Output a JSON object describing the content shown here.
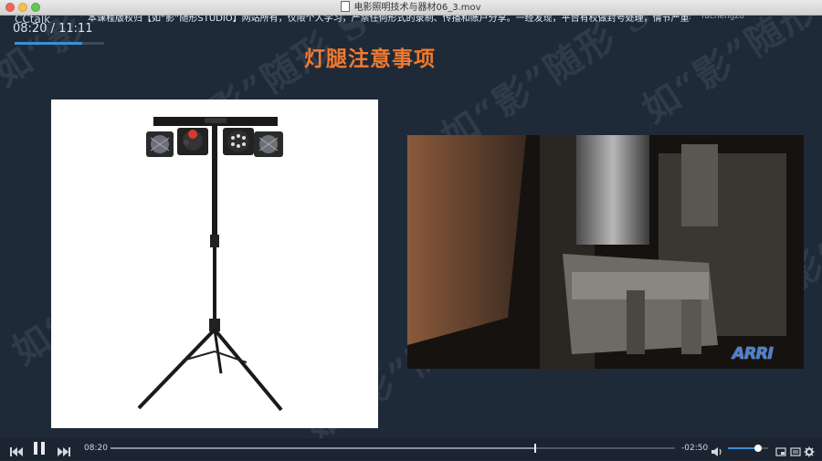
{
  "window": {
    "title": "电影照明技术与器材06_3.mov"
  },
  "overlay": {
    "app_name": "CCtalk",
    "notice": "本课程版权归【如“影”随形STUDIO】网站所有，仅限个人学习，严禁任何形式的录制、传播和账户分享。一经发现，平台有权做封号处理，情节严重者将承担法律责任。",
    "username": "fuchengzo",
    "time_display": "08:20 / 11:11",
    "mini_progress": 0.75
  },
  "slide": {
    "title": "灯腿注意事项",
    "watermark": "如“影”随形 STUDIO",
    "logo": "ARRI"
  },
  "player": {
    "current_time": "08:20",
    "remaining_time": "-02:50",
    "progress": 0.75,
    "volume": 0.7,
    "icons": [
      "rewind-icon",
      "pause-icon",
      "fast-forward-icon",
      "volume-icon",
      "picture-in-picture-icon",
      "playlist-icon",
      "settings-icon"
    ]
  }
}
